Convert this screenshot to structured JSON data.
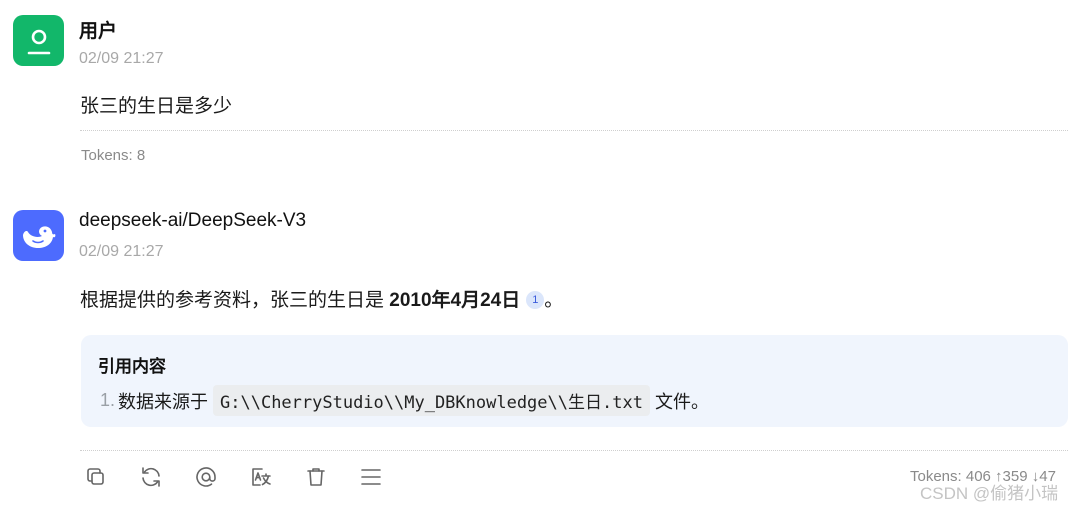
{
  "messages": {
    "user": {
      "name": "用户",
      "time": "02/09 21:27",
      "content": "张三的生日是多少",
      "tokens": "Tokens: 8"
    },
    "assistant": {
      "name": "deepseek-ai/DeepSeek-V3",
      "time": "02/09 21:27",
      "content_prefix": "根据提供的参考资料，张三的生日是 ",
      "content_bold": "2010年4月24日",
      "citation_number": "1",
      "content_suffix": "。",
      "tokens": "Tokens: 406 ↑359 ↓47"
    }
  },
  "references": {
    "title": "引用内容",
    "items": [
      {
        "number": "1.",
        "prefix": "数据来源于",
        "path": "G:\\\\CherryStudio\\\\My_DBKnowledge\\\\生日.txt",
        "suffix": "文件。"
      }
    ]
  },
  "toolbar": {
    "actions": [
      "copy-icon",
      "regenerate-icon",
      "mention-icon",
      "translate-icon",
      "delete-icon",
      "menu-icon"
    ]
  },
  "watermark": "CSDN @偷猪小瑞",
  "colors": {
    "user_avatar": "#12b76a",
    "assistant_avatar": "#4d6bfe",
    "reference_bg": "#f0f5fd"
  }
}
